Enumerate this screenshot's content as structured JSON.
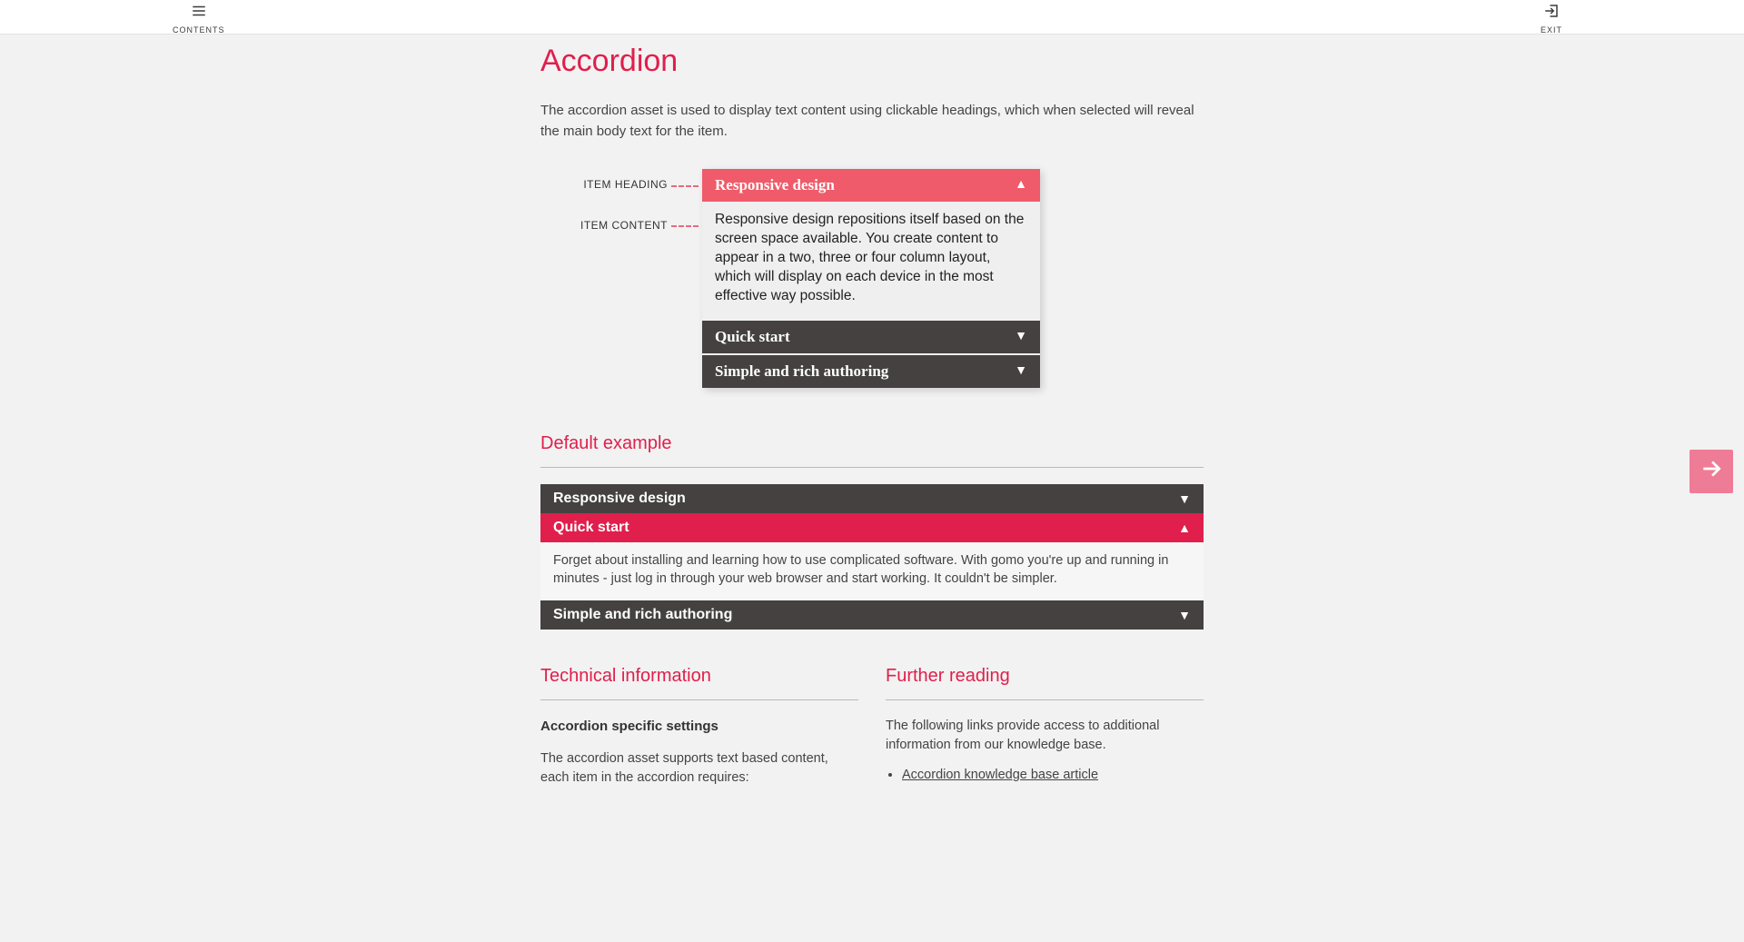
{
  "topbar": {
    "contents_label": "CONTENTS",
    "exit_label": "EXIT"
  },
  "page": {
    "title": "Accordion",
    "intro": "The accordion asset is used to display text content using clickable headings, which when selected will reveal the main body text for the item."
  },
  "diagram": {
    "label_heading": "ITEM HEADING",
    "label_content": "ITEM CONTENT",
    "items": [
      {
        "title": "Responsive design",
        "open": true,
        "body": "Responsive design repositions itself based on the screen space available. You create content to appear in a two, three or four column layout, which will display on each device in the most effective way possible."
      },
      {
        "title": "Quick start",
        "open": false
      },
      {
        "title": "Simple and rich authoring",
        "open": false
      }
    ]
  },
  "example": {
    "heading": "Default example",
    "items": [
      {
        "title": "Responsive design",
        "open": false
      },
      {
        "title": "Quick start",
        "open": true,
        "body": "Forget about installing and learning how to use complicated software. With gomo you're up and running in minutes - just log in through your web browser and start working. It couldn't be simpler."
      },
      {
        "title": "Simple and rich authoring",
        "open": false
      }
    ]
  },
  "technical": {
    "heading": "Technical information",
    "sub1": "Accordion specific settings",
    "p1": "The accordion asset supports text based content, each item in the accordion requires:"
  },
  "further": {
    "heading": "Further reading",
    "p1": "The following links provide access to additional information from our knowledge base.",
    "link1": "Accordion knowledge base article"
  }
}
